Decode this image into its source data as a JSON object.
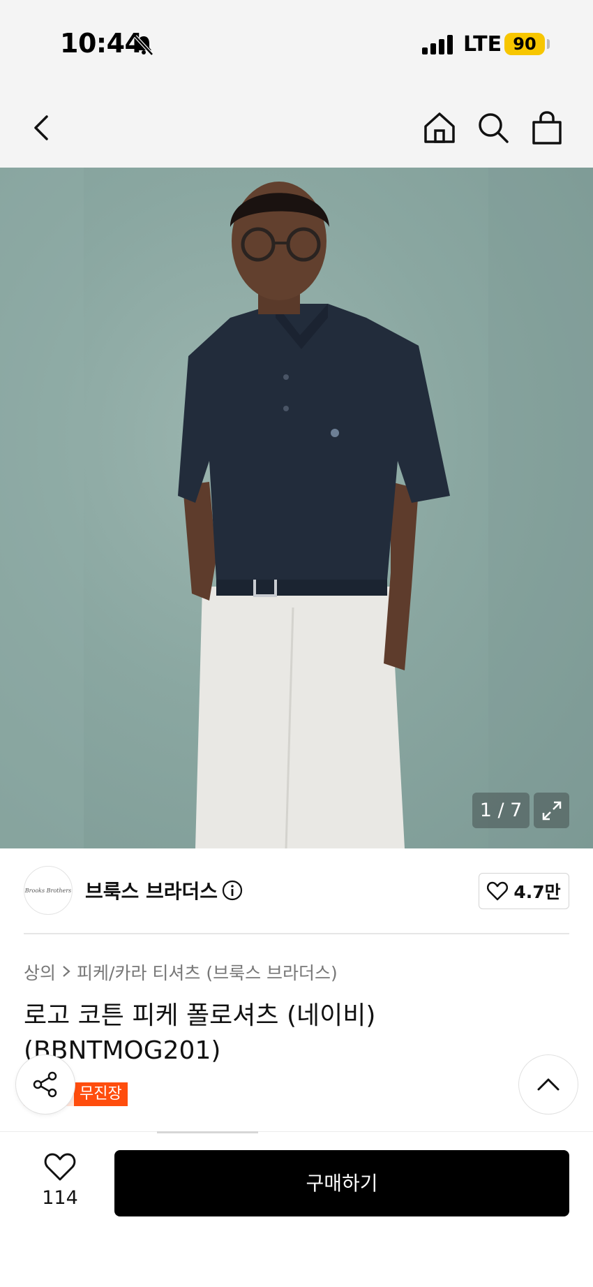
{
  "status_bar": {
    "time": "10:44",
    "network": "LTE",
    "battery": "90"
  },
  "nav": {
    "icons": [
      "chevron-left-icon",
      "home-icon",
      "search-icon",
      "shopping-bag-icon"
    ]
  },
  "gallery": {
    "counter": "1 / 7"
  },
  "brand": {
    "logo_text": "Brooks Brothers",
    "name": "브룩스 브라더스",
    "likes": "4.7만"
  },
  "breadcrumb": {
    "category": "상의",
    "subcategory": "피케/카라 티셔츠 (브룩스 브라더스)"
  },
  "product": {
    "title": "로고 코튼 피케 폴로셔츠 (네이비) (BBNTMOG201)",
    "badge": "무진장"
  },
  "bottom_bar": {
    "like_count": "114",
    "buy_label": "구매하기"
  },
  "colors": {
    "accent": "#ff4d0d",
    "battery": "#f7c600",
    "buy_button": "#000000"
  }
}
